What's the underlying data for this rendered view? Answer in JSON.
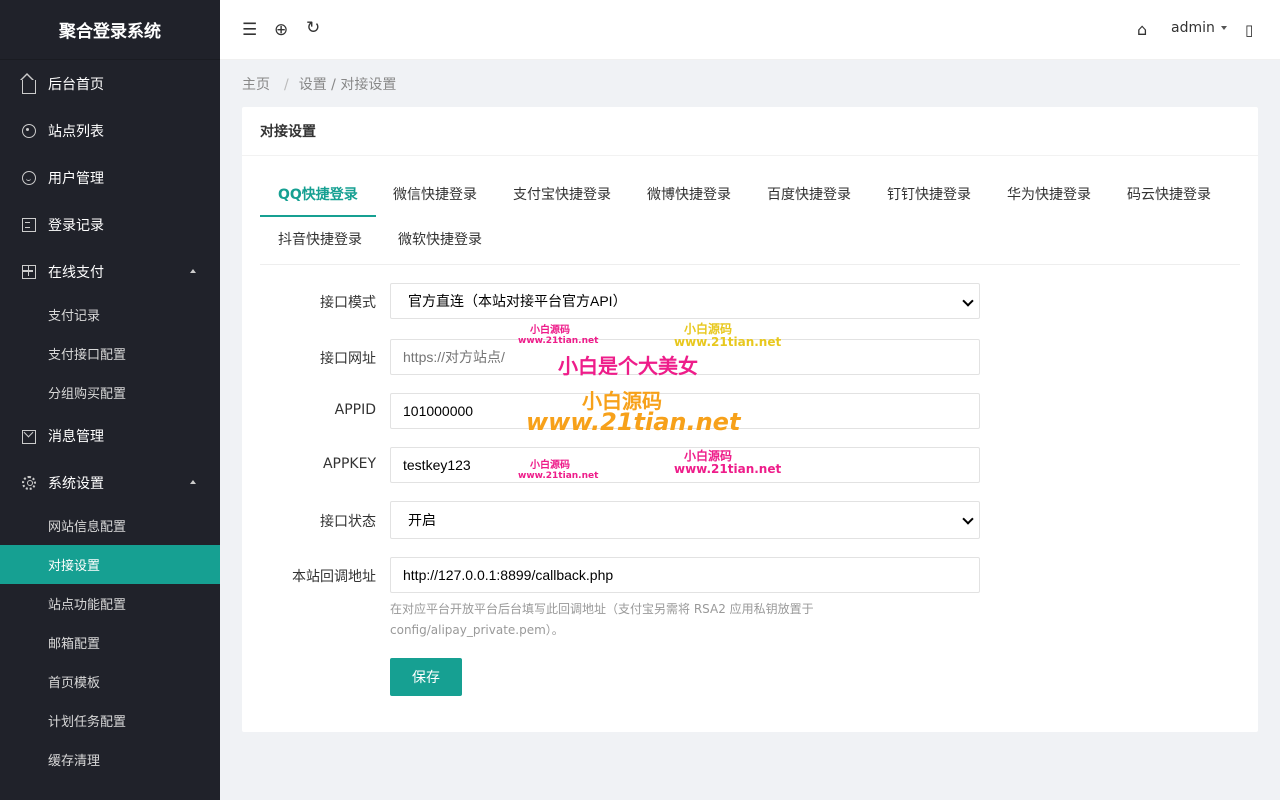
{
  "sidebar": {
    "brand": "聚合登录系统",
    "items": [
      {
        "label": "后台首页"
      },
      {
        "label": "站点列表"
      },
      {
        "label": "用户管理"
      },
      {
        "label": "登录记录"
      },
      {
        "label": "在线支付",
        "children": [
          "支付记录",
          "支付接口配置",
          "分组购买配置"
        ]
      },
      {
        "label": "消息管理"
      },
      {
        "label": "系统设置",
        "children": [
          "网站信息配置",
          "对接设置",
          "站点功能配置",
          "邮箱配置",
          "首页模板",
          "计划任务配置",
          "缓存清理"
        ]
      }
    ]
  },
  "header": {
    "menu_icon": "☰",
    "web_icon": "⊕",
    "refresh_icon": "↻",
    "home_icon": "⌂",
    "user": "admin",
    "phone_icon": "▯"
  },
  "breadcrumb": {
    "home": "主页",
    "sep": "/",
    "path": "设置 / 对接设置"
  },
  "card": {
    "title": "对接设置",
    "tabs": [
      "QQ快捷登录",
      "微信快捷登录",
      "支付宝快捷登录",
      "微博快捷登录",
      "百度快捷登录",
      "钉钉快捷登录",
      "华为快捷登录",
      "码云快捷登录",
      "抖音快捷登录",
      "微软快捷登录"
    ],
    "active_tab": 0,
    "form": {
      "mode_label": "接口模式",
      "mode_value": "官方直连（本站对接平台官方API）",
      "url_label": "接口网址",
      "url_placeholder": "https://对方站点/",
      "appid_label": "APPID",
      "appid_value": "101000000",
      "appkey_label": "APPKEY",
      "appkey_value": "testkey123",
      "status_label": "接口状态",
      "status_value": "开启",
      "callback_label": "本站回调地址",
      "callback_value": "http://127.0.0.1:8899/callback.php",
      "help_line1": "在对应平台开放平台后台填写此回调地址（支付宝另需将 RSA2 应用私钥放置于",
      "help_line2": "config/alipay_private.pem）。",
      "save_label": "保存"
    }
  },
  "watermarks": {
    "small_cn": "小白源码",
    "small_url": "www.21tian.net",
    "big_line1": "小白是个大美女",
    "big_line2": "小白源码",
    "big_line3": "www.21tian.net"
  },
  "colors": {
    "accent": "#16a092",
    "sidebar": "#20222a"
  }
}
